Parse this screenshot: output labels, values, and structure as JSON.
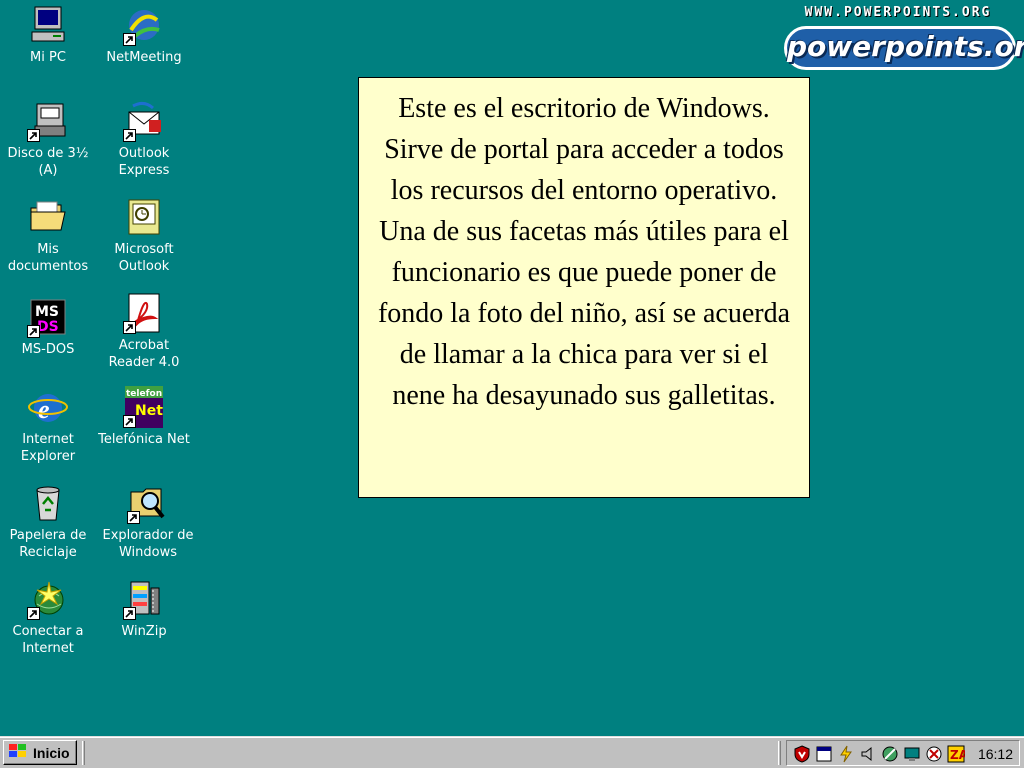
{
  "logo": {
    "small_text": "WWW.POWERPOINTS.ORG",
    "big_text": "powerpoints.org"
  },
  "desktop": {
    "icons": [
      {
        "label": "Mi PC",
        "icon": "computer-icon"
      },
      {
        "label": "NetMeeting",
        "icon": "netmeeting-icon"
      },
      {
        "label": "Disco de 3½\n(A)",
        "icon": "floppy-drive-icon"
      },
      {
        "label": "Outlook\nExpress",
        "icon": "outlook-express-icon"
      },
      {
        "label": "Mis\ndocumentos",
        "icon": "folder-icon"
      },
      {
        "label": "Microsoft\nOutlook",
        "icon": "outlook-icon"
      },
      {
        "label": "MS-DOS",
        "icon": "ms-dos-icon"
      },
      {
        "label": "Acrobat\nReader 4.0",
        "icon": "acrobat-icon"
      },
      {
        "label": "Internet\nExplorer",
        "icon": "internet-explorer-icon"
      },
      {
        "label": "Telefónica Net",
        "icon": "telefonica-net-icon"
      },
      {
        "label": "Papelera de\nReciclaje",
        "icon": "recycle-bin-icon"
      },
      {
        "label": "Explorador de\nWindows",
        "icon": "explorer-icon"
      },
      {
        "label": "Conectar a\nInternet",
        "icon": "connect-internet-icon"
      },
      {
        "label": "WinZip",
        "icon": "winzip-icon"
      }
    ]
  },
  "note": {
    "text": "Este es el escritorio de Windows. Sirve de portal para acceder a todos los recursos del entorno operativo. Una de sus facetas más útiles para el funcionario es que puede poner de fondo la foto del niño, así se acuerda de llamar a la chica para ver si el nene ha desayunado sus galletitas."
  },
  "taskbar": {
    "start_label": "Inicio",
    "clock": "16:12",
    "tray_icons": [
      "antivirus-shield-icon",
      "scheduler-icon",
      "power-icon",
      "speaker-icon",
      "network-icon",
      "display-icon",
      "antivirus-status-icon",
      "zonealarm-icon"
    ]
  },
  "colors": {
    "desktop": "#008080",
    "taskbar": "#c0c0c0",
    "note_background": "#ffffcc"
  }
}
